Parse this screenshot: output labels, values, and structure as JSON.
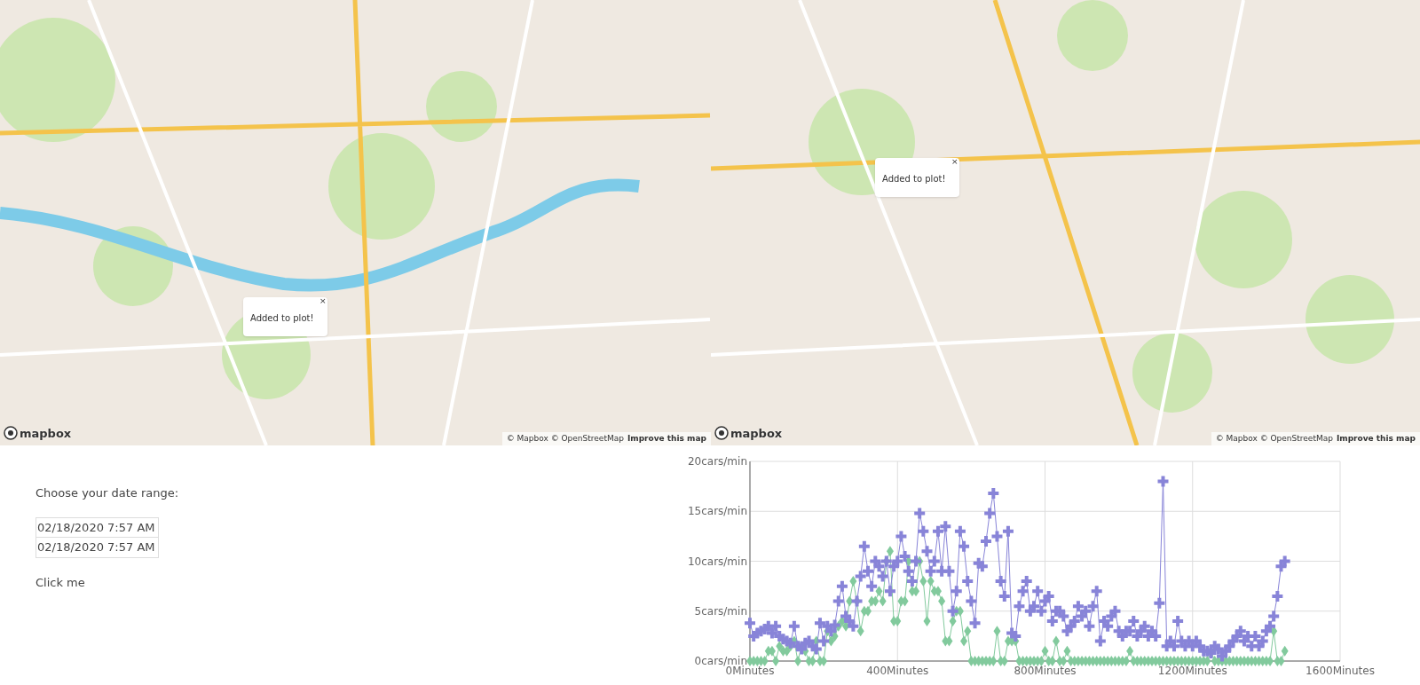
{
  "maps": [
    {
      "popup": {
        "text": "Added to plot!",
        "close": "×"
      },
      "logo": "mapbox",
      "attribution": "© Mapbox © OpenStreetMap",
      "improve_link": "Improve this map"
    },
    {
      "popup": {
        "text": "Added to plot!",
        "close": "×"
      },
      "logo": "mapbox",
      "attribution": "© Mapbox © OpenStreetMap",
      "improve_link": "Improve this map"
    }
  ],
  "date_range": {
    "label": "Choose your date range:",
    "start": "02/18/2020 7:57 AM",
    "end": "02/18/2020 7:57 AM"
  },
  "button": "Click me",
  "chart": {
    "chart_data": {
      "type": "line",
      "xlim": [
        0,
        1600
      ],
      "ylim": [
        0,
        20
      ],
      "xticks": [
        {
          "value": 0,
          "label": "0Minutes"
        },
        {
          "value": 400,
          "label": "400Minutes"
        },
        {
          "value": 800,
          "label": "800Minutes"
        },
        {
          "value": 1200,
          "label": "1200Minutes"
        },
        {
          "value": 1600,
          "label": "1600Minutes"
        }
      ],
      "yticks": [
        {
          "value": 0,
          "label": "0cars/min"
        },
        {
          "value": 5,
          "label": "5cars/min"
        },
        {
          "value": 10,
          "label": "10cars/min"
        },
        {
          "value": 15,
          "label": "15cars/min"
        },
        {
          "value": 20,
          "label": "20cars/min"
        }
      ],
      "grid": true,
      "x": [
        0,
        10,
        20,
        30,
        40,
        50,
        60,
        70,
        80,
        90,
        100,
        110,
        120,
        130,
        140,
        150,
        160,
        170,
        180,
        190,
        200,
        210,
        220,
        230,
        240,
        250,
        260,
        270,
        280,
        290,
        300,
        310,
        320,
        330,
        340,
        350,
        360,
        370,
        380,
        390,
        400,
        410,
        420,
        430,
        440,
        450,
        460,
        470,
        480,
        490,
        500,
        510,
        520,
        530,
        540,
        550,
        560,
        570,
        580,
        590,
        600,
        610,
        620,
        630,
        640,
        650,
        660,
        670,
        680,
        690,
        700,
        710,
        720,
        730,
        740,
        750,
        760,
        770,
        780,
        790,
        800,
        810,
        820,
        830,
        840,
        850,
        860,
        870,
        880,
        890,
        900,
        910,
        920,
        930,
        940,
        950,
        960,
        970,
        980,
        990,
        1000,
        1010,
        1020,
        1030,
        1040,
        1050,
        1060,
        1070,
        1080,
        1090,
        1100,
        1110,
        1120,
        1130,
        1140,
        1150,
        1160,
        1170,
        1180,
        1190,
        1200,
        1210,
        1220,
        1230,
        1240,
        1250,
        1260,
        1270,
        1280,
        1290,
        1300,
        1310,
        1320,
        1330,
        1340,
        1350,
        1360,
        1370,
        1380,
        1390,
        1400,
        1410,
        1420,
        1430,
        1440,
        1450
      ],
      "series": [
        {
          "color": "#8884d8",
          "marker": "cross",
          "values": [
            3.8,
            2.5,
            2.8,
            3,
            3.2,
            3.5,
            2.8,
            3.5,
            2.5,
            2.2,
            2,
            1.8,
            3.5,
            1.5,
            1.2,
            1.8,
            2,
            1.5,
            1.2,
            3.8,
            2,
            3.5,
            3,
            3.6,
            6,
            7.5,
            4.5,
            4,
            3.5,
            6,
            8.5,
            11.5,
            9,
            7.5,
            10,
            9.5,
            8.5,
            10,
            7,
            9.5,
            10,
            12.5,
            10.5,
            9,
            8,
            10,
            14.8,
            13,
            11,
            9,
            10,
            13,
            9,
            13.5,
            9,
            5,
            7,
            13,
            11.5,
            8,
            6,
            3.8,
            9.8,
            9.5,
            12,
            14.8,
            16.8,
            12.5,
            8,
            6.5,
            13,
            2.8,
            2.5,
            5.5,
            7,
            8,
            5,
            5.5,
            7,
            5,
            6,
            6.5,
            4,
            5,
            5,
            4.5,
            3,
            3.5,
            4,
            5.5,
            4.5,
            5,
            3.5,
            5.5,
            7,
            2,
            4,
            3.5,
            4.5,
            5,
            3,
            2.5,
            3,
            3,
            4,
            2.5,
            3,
            3.5,
            2.5,
            3,
            2.5,
            5.8,
            18,
            1.5,
            2,
            1.5,
            4,
            2,
            1.5,
            2,
            1.5,
            2,
            1.5,
            1,
            1,
            0.8,
            1.5,
            1.2,
            0.5,
            1,
            1.5,
            2,
            2.5,
            3,
            2,
            2.5,
            1.5,
            2.5,
            1.5,
            2,
            3,
            3.5,
            4.5,
            6.5,
            9.5,
            10
          ]
        },
        {
          "color": "#82ca9d",
          "marker": "diamond",
          "values": [
            0,
            0,
            0,
            0,
            0,
            1,
            1,
            0,
            1.5,
            1,
            1,
            1.5,
            2,
            0,
            1.5,
            1,
            0,
            0,
            2,
            0,
            0,
            3,
            2,
            2.5,
            3.5,
            4,
            3.5,
            6,
            8,
            6,
            3,
            5,
            5,
            6,
            6,
            7,
            6,
            10,
            11,
            4,
            4,
            6,
            6,
            10,
            7,
            7,
            10,
            8,
            4,
            8,
            7,
            7,
            6,
            2,
            2,
            4,
            5,
            5,
            2,
            3,
            0,
            0,
            0,
            0,
            0,
            0,
            0,
            3,
            0,
            0,
            2,
            2,
            2,
            0,
            0,
            0,
            0,
            0,
            0,
            0,
            1,
            0,
            0,
            2,
            0,
            0,
            1,
            0,
            0,
            0,
            0,
            0,
            0,
            0,
            0,
            0,
            0,
            0,
            0,
            0,
            0,
            0,
            0,
            1,
            0,
            0,
            0,
            0,
            0,
            0,
            0,
            0,
            0,
            0,
            0,
            0,
            0,
            0,
            0,
            0,
            0,
            0,
            0,
            0,
            0,
            1,
            0,
            0,
            0,
            0,
            0,
            0,
            0,
            0,
            0,
            0,
            0,
            0,
            0,
            0,
            0,
            0,
            3,
            0,
            0,
            1
          ]
        }
      ]
    }
  }
}
